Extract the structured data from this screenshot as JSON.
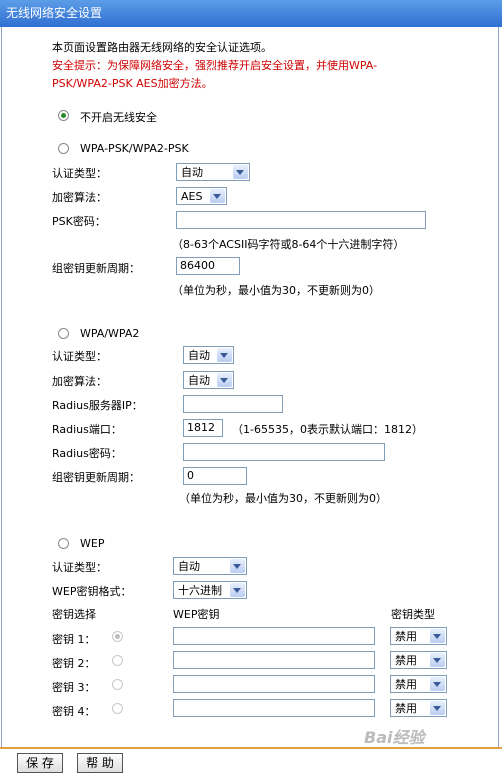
{
  "window": {
    "title": "无线网络安全设置"
  },
  "intro": {
    "desc": "本页面设置路由器无线网络的安全认证选项。",
    "warn1": "安全提示：为保障网络安全，强烈推荐开启安全设置，并使用WPA-",
    "warn2": "PSK/WPA2-PSK AES加密方法。"
  },
  "mode_none": {
    "label": "不开启无线安全"
  },
  "wpa_psk": {
    "title": "WPA-PSK/WPA2-PSK",
    "auth_label": "认证类型：",
    "auth_value": "自动",
    "enc_label": "加密算法：",
    "enc_value": "AES",
    "psk_label": "PSK密码：",
    "psk_value": "",
    "psk_hint": "（8-63个ACSII码字符或8-64个十六进制字符）",
    "period_label": "组密钥更新周期：",
    "period_value": "86400",
    "period_hint": "（单位为秒，最小值为30，不更新则为0）"
  },
  "wpa": {
    "title": "WPA/WPA2",
    "auth_label": "认证类型：",
    "auth_value": "自动",
    "enc_label": "加密算法：",
    "enc_value": "自动",
    "radius_ip_label": "Radius服务器IP：",
    "radius_ip_value": "",
    "radius_port_label": "Radius端口：",
    "radius_port_value": "1812",
    "radius_port_hint": "（1-65535，0表示默认端口：1812）",
    "radius_pwd_label": "Radius密码：",
    "radius_pwd_value": "",
    "period_label": "组密钥更新周期：",
    "period_value": "0",
    "period_hint": "（单位为秒，最小值为30，不更新则为0）"
  },
  "wep": {
    "title": "WEP",
    "auth_label": "认证类型：",
    "auth_value": "自动",
    "format_label": "WEP密钥格式：",
    "format_value": "十六进制",
    "col_select": "密钥选择",
    "col_key": "WEP密钥",
    "col_type": "密钥类型",
    "keys": [
      {
        "label": "密钥 1：",
        "value": "",
        "type": "禁用"
      },
      {
        "label": "密钥 2：",
        "value": "",
        "type": "禁用"
      },
      {
        "label": "密钥 3：",
        "value": "",
        "type": "禁用"
      },
      {
        "label": "密钥 4：",
        "value": "",
        "type": "禁用"
      }
    ]
  },
  "actions": {
    "save": "保 存",
    "help": "帮 助"
  },
  "watermark": {
    "text": "Bai经验"
  }
}
